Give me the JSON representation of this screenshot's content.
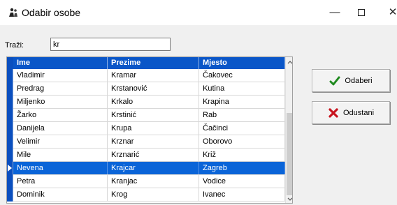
{
  "window": {
    "title": "Odabir osobe",
    "controls": {
      "minimize": "—",
      "close": "✕"
    }
  },
  "search": {
    "label": "Traži:",
    "value": "kr"
  },
  "grid": {
    "columns": [
      "Ime",
      "Prezime",
      "Mjesto"
    ],
    "rows": [
      [
        "Vladimir",
        "Kramar",
        "Čakovec"
      ],
      [
        "Predrag",
        "Krstanović",
        "Kutina"
      ],
      [
        "Miljenko",
        "Krkalo",
        "Krapina"
      ],
      [
        "Žarko",
        "Krstinić",
        "Rab"
      ],
      [
        "Danijela",
        "Krupa",
        "Čačinci"
      ],
      [
        "Velimir",
        "Krznar",
        "Oborovo"
      ],
      [
        "Mile",
        "Krznarić",
        "Križ"
      ],
      [
        "Nevena",
        "Krajcar",
        "Zagreb"
      ],
      [
        "Petra",
        "Kranjac",
        "Vodice"
      ],
      [
        "Dominik",
        "Krog",
        "Ivanec"
      ]
    ],
    "selected_index": 7
  },
  "buttons": {
    "ok_label": "Odaberi",
    "cancel_label": "Odustani"
  },
  "colors": {
    "header_bg": "#0a56c8",
    "selection_bg": "#0a64d8",
    "ok_icon": "#1f8a1f",
    "cancel_icon": "#c8141e"
  },
  "icons": {
    "app": "persons-icon",
    "ok": "checkmark-icon",
    "cancel": "x-icon"
  }
}
